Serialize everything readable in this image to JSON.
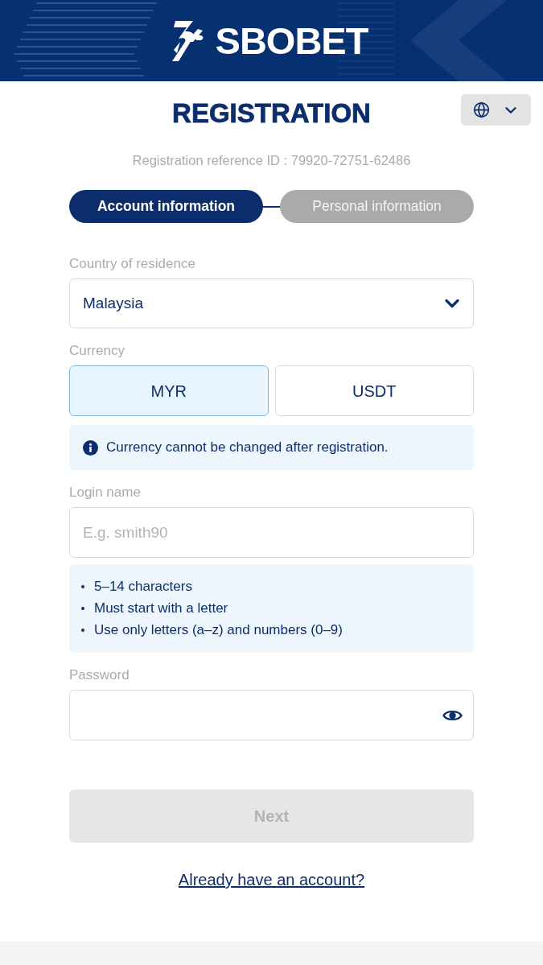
{
  "header": {
    "logo_text": "SBOBET"
  },
  "title": "REGISTRATION",
  "reference": "Registration reference ID : 79920-72751-62486",
  "steps": [
    {
      "label": "Account information",
      "selected": true
    },
    {
      "label": "Personal information",
      "selected": false
    }
  ],
  "country": {
    "label": "Country of residence",
    "value": "Malaysia"
  },
  "currency": {
    "label": "Currency",
    "options": [
      {
        "label": "MYR",
        "selected": true
      },
      {
        "label": "USDT",
        "selected": false
      }
    ],
    "notice": "Currency cannot be changed after registration."
  },
  "login": {
    "label": "Login name",
    "placeholder": "E.g. smith90",
    "rules": [
      "5–14 characters",
      "Must start with a letter",
      "Use only letters (a–z) and numbers (0–9)"
    ]
  },
  "password": {
    "label": "Password"
  },
  "next_button": {
    "label": "Next",
    "disabled": true
  },
  "login_link": "Already have an account?"
}
